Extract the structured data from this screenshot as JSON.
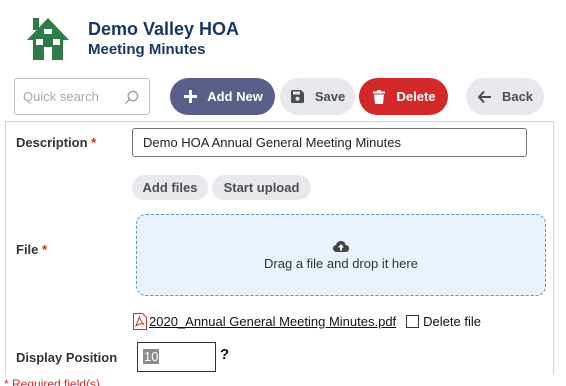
{
  "header": {
    "org_name": "Demo Valley HOA",
    "page_name": "Meeting Minutes",
    "logo_icon": "house-icon",
    "logo_color": "#2e7d46"
  },
  "toolbar": {
    "search_placeholder": "Quick search",
    "add_new_label": "Add New",
    "save_label": "Save",
    "delete_label": "Delete",
    "back_label": "Back"
  },
  "form": {
    "description": {
      "label": "Description",
      "required_mark": "*",
      "value": "Demo HOA Annual General Meeting Minutes"
    },
    "add_files_label": "Add files",
    "start_upload_label": "Start upload",
    "file": {
      "label": "File",
      "required_mark": "*",
      "dropzone_text": "Drag a file and drop it here",
      "existing_file_name": "2020_Annual General Meeting Minutes.pdf",
      "delete_file_label": "Delete file",
      "delete_checked": false
    },
    "display_position": {
      "label": "Display Position",
      "value": "10",
      "help_text": "?"
    }
  },
  "footer": {
    "required_note": "* Required field(s)"
  },
  "colors": {
    "title": "#17375e",
    "primary": "#5b5e88",
    "danger": "#d22a2b",
    "secondary": "#e7e8ec",
    "dropzone_bg": "#e9f2fb",
    "dropzone_border": "#4b9fc6"
  }
}
